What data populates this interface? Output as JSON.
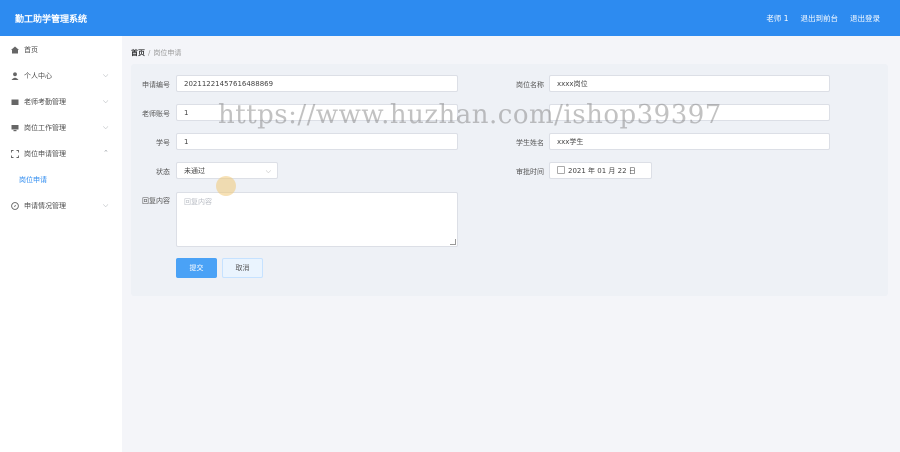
{
  "header": {
    "app_title": "勤工助学管理系统",
    "user_label": "老师 1",
    "to_home": "退出到前台",
    "logout": "退出登录"
  },
  "sidebar": {
    "items": [
      {
        "label": "首页",
        "icon": "home-icon"
      },
      {
        "label": "个人中心",
        "icon": "user-icon"
      },
      {
        "label": "老师考勤管理",
        "icon": "folder-icon"
      },
      {
        "label": "岗位工作管理",
        "icon": "monitor-icon"
      },
      {
        "label": "岗位申请管理",
        "icon": "scan-icon"
      },
      {
        "label": "申请情况管理",
        "icon": "compass-icon"
      }
    ],
    "sub_item": "岗位申请"
  },
  "breadcrumb": {
    "home": "首页",
    "separator": "/",
    "current": "岗位申请"
  },
  "form": {
    "apply_no_label": "申请编号",
    "apply_no_value": "20211221457616488869",
    "post_name_label": "岗位名称",
    "post_name_value": "xxxx岗位",
    "teacher_account_label": "老师账号",
    "teacher_account_value": "1",
    "student_no_label": "学号",
    "student_no_value": "1",
    "student_name_label": "学生姓名",
    "student_name_value": "xxx学生",
    "status_label": "状态",
    "status_value": "未通过",
    "audit_time_label": "审批时间",
    "audit_time_value": "2021 年 01 月 22 日",
    "reply_label": "回复内容",
    "reply_placeholder": "回复内容",
    "submit": "提交",
    "cancel": "取消"
  },
  "watermark": "https://www.huzhan.com/ishop39397",
  "colors": {
    "header": "#2d8bf0",
    "accent": "#2d8bf0",
    "submit": "#4aa2f6"
  }
}
